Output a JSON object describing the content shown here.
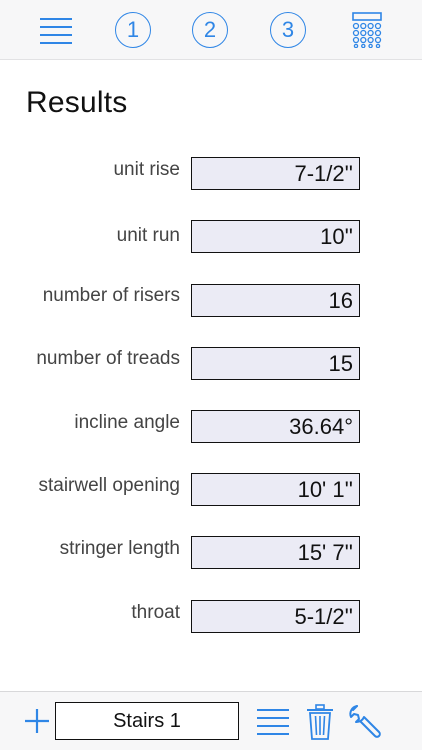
{
  "toolbar": {
    "menu_icon": "hamburger-menu-icon",
    "step1_label": "1",
    "step2_label": "2",
    "step3_label": "3",
    "calculator_icon": "calculator-keypad-icon",
    "accent_color": "#2f86e6"
  },
  "page": {
    "title": "Results"
  },
  "results": [
    {
      "label": "unit rise",
      "value": "7-1/2''"
    },
    {
      "label": "unit run",
      "value": "10''"
    },
    {
      "label": "number of risers",
      "value": "16"
    },
    {
      "label": "number of treads",
      "value": "15"
    },
    {
      "label": "incline angle",
      "value": "36.64°"
    },
    {
      "label": "stairwell opening",
      "value": "10' 1''"
    },
    {
      "label": "stringer length",
      "value": "15' 7''"
    },
    {
      "label": "throat",
      "value": "5-1/2''"
    }
  ],
  "bottombar": {
    "add_icon": "plus-icon",
    "project_name": "Stairs 1",
    "list_icon": "list-icon",
    "delete_icon": "trash-icon",
    "settings_icon": "wrench-icon"
  }
}
